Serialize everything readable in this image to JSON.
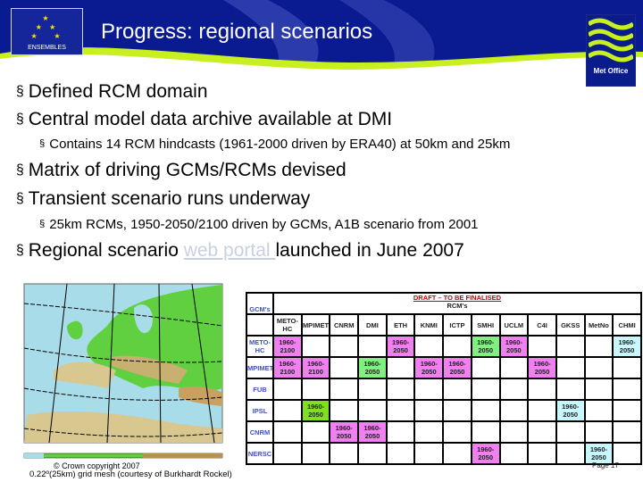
{
  "header": {
    "title": "Progress: regional scenarios",
    "left_logo": "ENSEMBLES",
    "right_logo": "Met Office"
  },
  "bullets": [
    {
      "level": 1,
      "text": "Defined RCM domain"
    },
    {
      "level": 1,
      "text": "Central model data archive available at DMI"
    },
    {
      "level": 2,
      "text": "Contains 14 RCM hindcasts (1961-2000 driven by ERA40) at 50km and 25km"
    },
    {
      "level": 1,
      "text": "Matrix of driving GCMs/RCMs devised"
    },
    {
      "level": 1,
      "text": "Transient scenario runs underway"
    },
    {
      "level": 2,
      "text": "25km RCMs, 1950-2050/2100 driven by GCMs, A1B scenario from 2001"
    }
  ],
  "last_bullet": {
    "before": "Regional scenario ",
    "link": "web portal ",
    "after": "launched in June 2007"
  },
  "bullet_icon": "square-bullet",
  "map": {
    "copyright": "© Crown copyright 2007",
    "caption": "0.22º(25km) grid mesh (courtesy of Burkhardt Rockel)"
  },
  "matrix": {
    "gcm_label": "GCM's",
    "draft": "DRAFT – TO BE FINALISED",
    "rcm_label": "RCM's",
    "columns": [
      "METO-HC",
      "MPIMET",
      "CNRM",
      "DMI",
      "ETH",
      "KNMI",
      "ICTP",
      "SMHI",
      "UCLM",
      "C4I",
      "GKSS",
      "MetNo",
      "CHMI"
    ],
    "rows": [
      {
        "gcm": "METO-HC",
        "cells": [
          {
            "t": "1960-2100",
            "c": "pink"
          },
          null,
          null,
          null,
          {
            "t": "1960-2050",
            "c": "pink"
          },
          null,
          null,
          {
            "t": "1960-2050",
            "c": "green"
          },
          {
            "t": "1960-2050",
            "c": "pink"
          },
          null,
          null,
          null,
          {
            "t": "1960-2050",
            "c": "cyan"
          }
        ]
      },
      {
        "gcm": "MPIMET",
        "cells": [
          {
            "t": "1960-2100",
            "c": "pink"
          },
          {
            "t": "1960-2100",
            "c": "pink"
          },
          null,
          {
            "t": "1960-2050",
            "c": "green"
          },
          null,
          {
            "t": "1960-2050",
            "c": "pink"
          },
          {
            "t": "1960-2050",
            "c": "pink"
          },
          null,
          null,
          {
            "t": "1960-2050",
            "c": "pink"
          },
          null,
          null,
          null
        ]
      },
      {
        "gcm": "FUB",
        "cells": [
          null,
          null,
          null,
          null,
          null,
          null,
          null,
          null,
          null,
          null,
          null,
          null,
          null
        ]
      },
      {
        "gcm": "IPSL",
        "cells": [
          null,
          {
            "t": "1960-2050",
            "c": "lime"
          },
          null,
          null,
          null,
          null,
          null,
          null,
          null,
          null,
          {
            "t": "1960-2050",
            "c": "cyan"
          },
          null,
          null
        ]
      },
      {
        "gcm": "CNRM",
        "cells": [
          null,
          null,
          {
            "t": "1960-2050",
            "c": "pink"
          },
          {
            "t": "1960-2050",
            "c": "pink"
          },
          null,
          null,
          null,
          null,
          null,
          null,
          null,
          null,
          null
        ]
      },
      {
        "gcm": "NERSC",
        "cells": [
          null,
          null,
          null,
          null,
          null,
          null,
          null,
          {
            "t": "1960-2050",
            "c": "pink"
          },
          null,
          null,
          null,
          {
            "t": "1960-2050",
            "c": "cyan"
          },
          null
        ]
      }
    ]
  },
  "page": "Page 17"
}
